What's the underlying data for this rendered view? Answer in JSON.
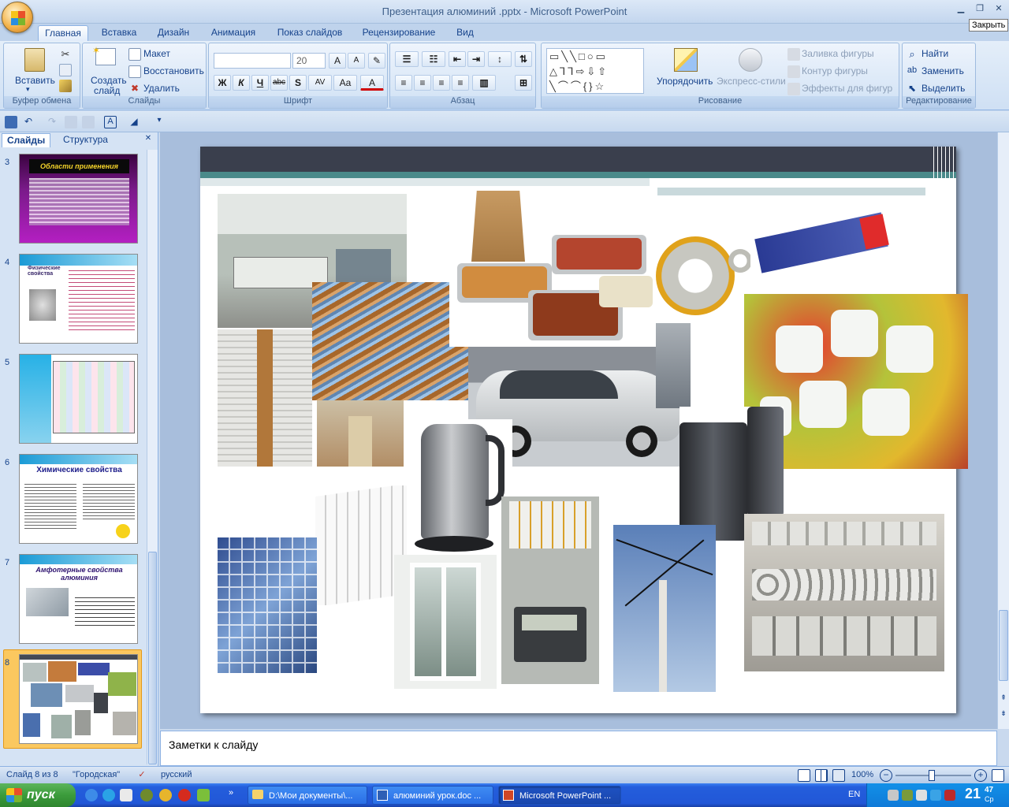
{
  "window": {
    "title": "Презентация алюминий .pptx - Microsoft PowerPoint",
    "close_tooltip": "Закрыть"
  },
  "ribbon_tabs": [
    "Главная",
    "Вставка",
    "Дизайн",
    "Анимация",
    "Показ слайдов",
    "Рецензирование",
    "Вид"
  ],
  "ribbon": {
    "clipboard": {
      "label": "Буфер обмена",
      "paste": "Вставить"
    },
    "slides": {
      "label": "Слайды",
      "new_slide_1": "Создать",
      "new_slide_2": "слайд",
      "layout": "Макет",
      "reset": "Восстановить",
      "delete": "Удалить"
    },
    "font": {
      "label": "Шрифт",
      "font_name": "",
      "font_size": "20",
      "bold": "Ж",
      "italic": "К",
      "underline": "Ч",
      "strike": "abc",
      "shadow": "S",
      "spacing": "AV",
      "case": "Aa",
      "color": "A",
      "grow": "A",
      "shrink": "A"
    },
    "paragraph": {
      "label": "Абзац"
    },
    "drawing": {
      "label": "Рисование",
      "arrange": "Упорядочить",
      "quick_styles": "Экспресс-стили",
      "shape_fill": "Заливка фигуры",
      "shape_outline": "Контур фигуры",
      "shape_effects": "Эффекты для фигур"
    },
    "editing": {
      "label": "Редактирование",
      "find": "Найти",
      "replace": "Заменить",
      "select": "Выделить"
    }
  },
  "panel": {
    "tabs": [
      "Слайды",
      "Структура"
    ],
    "slides": [
      {
        "num": "3",
        "title": "Области применения"
      },
      {
        "num": "4",
        "title": "Физические свойства"
      },
      {
        "num": "5",
        "title": ""
      },
      {
        "num": "6",
        "title": "Химические свойства"
      },
      {
        "num": "7",
        "title": "Амфотерные свойства алюминия"
      },
      {
        "num": "8",
        "title": ""
      }
    ],
    "selected_slide": "8"
  },
  "slide": {
    "images": [
      {
        "name": "office-interior-image",
        "color": "#c8cec9"
      },
      {
        "name": "window-blinds-image",
        "color": "#6d8fb5"
      },
      {
        "name": "food-containers-image",
        "color": "#c47b3c"
      },
      {
        "name": "aluminium-tape-image",
        "color": "#b9b9b2"
      },
      {
        "name": "foil-box-image",
        "color": "#3b4da8"
      },
      {
        "name": "vitamin-jars-fruit-image",
        "color": "#8fb34a"
      },
      {
        "name": "glass-partition-image",
        "color": "#c6b59a"
      },
      {
        "name": "car-image",
        "color": "#c5c8cb"
      },
      {
        "name": "kettle-image",
        "color": "#6d6f73"
      },
      {
        "name": "coffee-machine-image",
        "color": "#3e4248"
      },
      {
        "name": "radiator-image",
        "color": "#ebebeb"
      },
      {
        "name": "glass-facade-image",
        "color": "#4a6fae"
      },
      {
        "name": "plastic-window-image",
        "color": "#9fb0a8"
      },
      {
        "name": "electric-meter-image",
        "color": "#9a9c98"
      },
      {
        "name": "power-line-image",
        "color": "#6f8fbf"
      },
      {
        "name": "cookware-shop-image",
        "color": "#b5b3ad"
      }
    ]
  },
  "notes": {
    "placeholder": "Заметки к слайду"
  },
  "status": {
    "slide": "Слайд 8 из 8",
    "theme": "\"Городская\"",
    "language": "русский",
    "zoom": "100%"
  },
  "taskbar": {
    "start": "пуск",
    "buttons": [
      "D:\\Мои документы\\...",
      "алюминий урок.doc ...",
      "Microsoft PowerPoint ..."
    ],
    "lang": "EN",
    "clock": "21",
    "clock_min": "47",
    "clock_day": "Ср"
  }
}
